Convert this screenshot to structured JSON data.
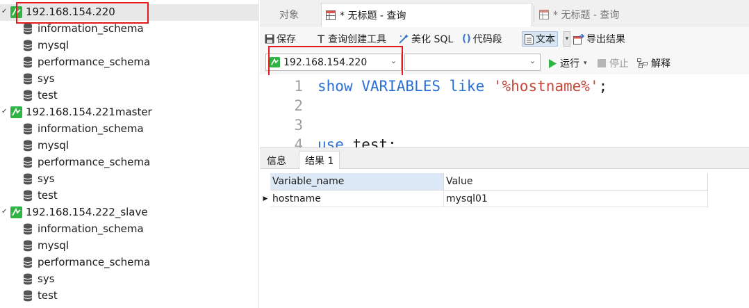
{
  "navigator": {
    "connections": [
      {
        "name": "192.168.154.220",
        "expanded": true,
        "selected": true,
        "databases": [
          "information_schema",
          "mysql",
          "performance_schema",
          "sys",
          "test"
        ]
      },
      {
        "name": "192.168.154.221master",
        "expanded": false,
        "selected": false,
        "databases": [
          "information_schema",
          "mysql",
          "performance_schema",
          "sys",
          "test"
        ]
      },
      {
        "name": "192.168.154.222_slave",
        "expanded": false,
        "selected": false,
        "databases": [
          "information_schema",
          "mysql",
          "performance_schema",
          "sys",
          "test"
        ]
      }
    ]
  },
  "tabs": {
    "objects": "对象",
    "active_query": "* 无标题 - 查询",
    "other_query": "* 无标题 - 查询"
  },
  "toolbar": {
    "save": "保存",
    "query_builder": "查询创建工具",
    "beautify_sql": "美化 SQL",
    "code_snippet": "代码段",
    "text": "文本",
    "export_results": "导出结果"
  },
  "selectors": {
    "connection_value": "192.168.154.220",
    "database_value": "",
    "run": "运行",
    "stop": "停止",
    "explain": "解释"
  },
  "editor": {
    "line_numbers": [
      "1",
      "2",
      "3",
      "4"
    ],
    "line1": {
      "kw": "show VARIABLES like ",
      "str": "'%hostname%'",
      "rest": ";"
    },
    "line4": {
      "kw": "use",
      "rest": " test;"
    }
  },
  "results": {
    "tabs": [
      "信息",
      "结果 1"
    ],
    "columns": [
      "Variable_name",
      "Value"
    ],
    "rows": [
      [
        "hostname",
        "mysql01"
      ]
    ]
  },
  "colors": {
    "highlight_box": "#e21a1a",
    "keyword": "#2a6fd6",
    "string": "#c5473b",
    "connection_icon": "#2fb344"
  }
}
